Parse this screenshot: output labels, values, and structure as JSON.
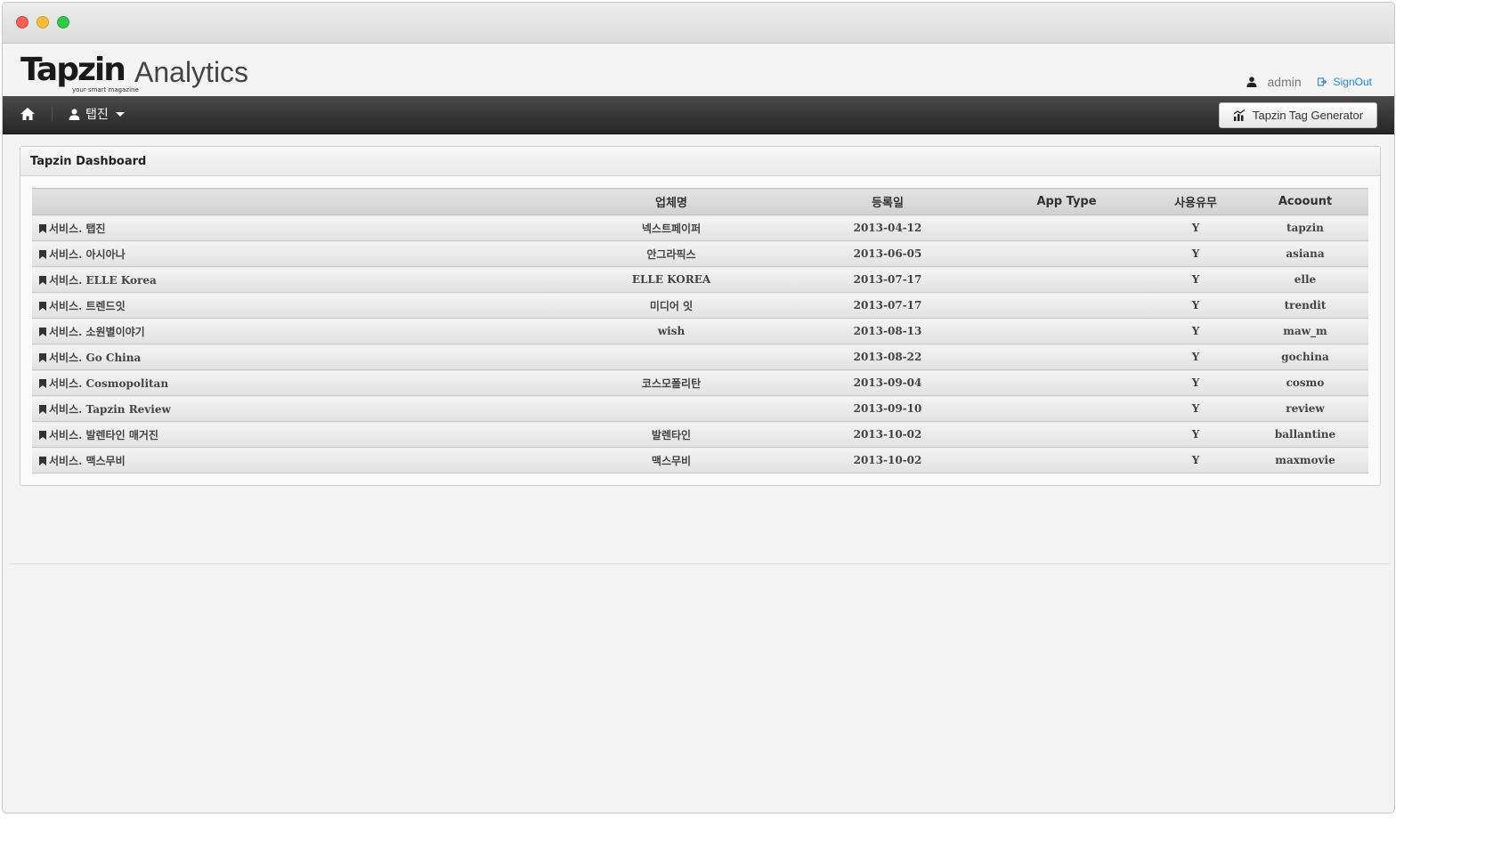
{
  "header": {
    "logo_main": "Tapzin",
    "logo_sub": "your smart magazine",
    "logo_product": "Analytics",
    "user": "admin",
    "signout_label": "SignOut"
  },
  "nav": {
    "menu_label": "탭진",
    "tag_generator_label": "Tapzin Tag Generator"
  },
  "panel": {
    "title": "Tapzin Dashboard"
  },
  "table": {
    "headers": [
      "",
      "업체명",
      "등록일",
      "App Type",
      "사용유무",
      "Acoount"
    ],
    "rows": [
      {
        "service": "서비스. 탭진",
        "company": "넥스트페이퍼",
        "date": "2013-04-12",
        "app_type": "",
        "active": "Y",
        "account": "tapzin"
      },
      {
        "service": "서비스. 아시아나",
        "company": "안그라픽스",
        "date": "2013-06-05",
        "app_type": "",
        "active": "Y",
        "account": "asiana"
      },
      {
        "service": "서비스. ELLE Korea",
        "company": "ELLE KOREA",
        "date": "2013-07-17",
        "app_type": "",
        "active": "Y",
        "account": "elle"
      },
      {
        "service": "서비스. 트렌드잇",
        "company": "미디어 잇",
        "date": "2013-07-17",
        "app_type": "",
        "active": "Y",
        "account": "trendit"
      },
      {
        "service": "서비스. 소원별이야기",
        "company": "wish",
        "date": "2013-08-13",
        "app_type": "",
        "active": "Y",
        "account": "maw_m"
      },
      {
        "service": "서비스. Go China",
        "company": "",
        "date": "2013-08-22",
        "app_type": "",
        "active": "Y",
        "account": "gochina"
      },
      {
        "service": "서비스. Cosmopolitan",
        "company": "코스모폴리탄",
        "date": "2013-09-04",
        "app_type": "",
        "active": "Y",
        "account": "cosmo"
      },
      {
        "service": "서비스. Tapzin Review",
        "company": "",
        "date": "2013-09-10",
        "app_type": "",
        "active": "Y",
        "account": "review"
      },
      {
        "service": "서비스. 발렌타인 매거진",
        "company": "발렌타인",
        "date": "2013-10-02",
        "app_type": "",
        "active": "Y",
        "account": "ballantine"
      },
      {
        "service": "서비스. 맥스무비",
        "company": "맥스무비",
        "date": "2013-10-02",
        "app_type": "",
        "active": "Y",
        "account": "maxmovie"
      }
    ]
  },
  "colors": {
    "navbar": "#333333",
    "link": "#2a84d2",
    "background": "#f3f3f3"
  }
}
